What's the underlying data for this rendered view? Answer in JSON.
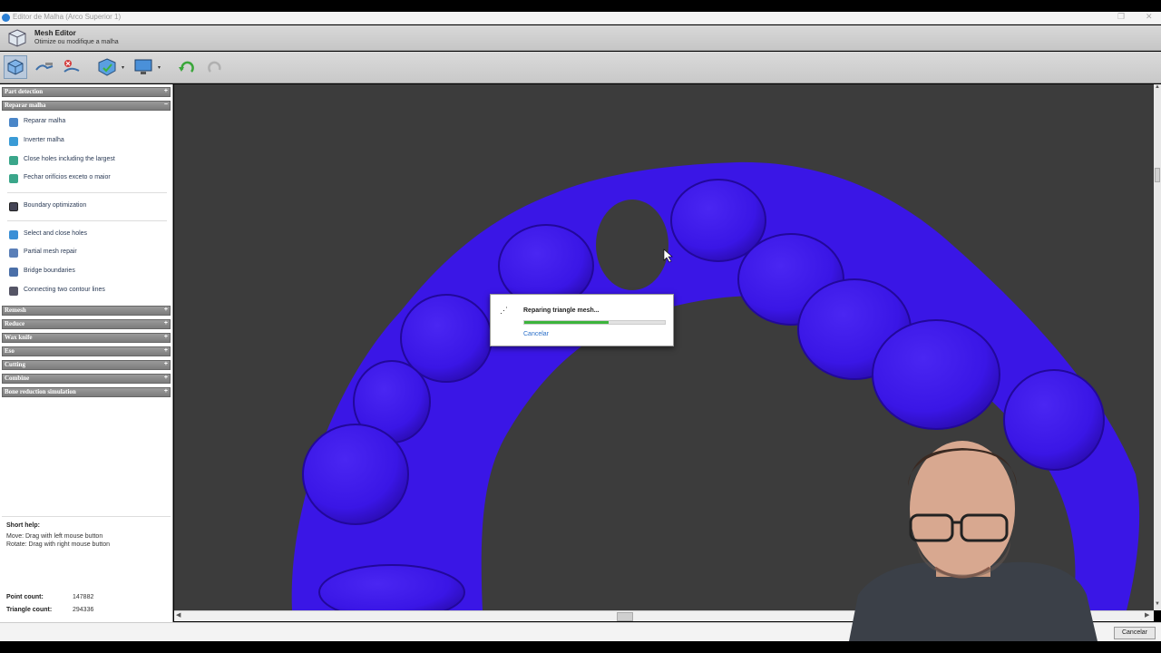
{
  "window": {
    "title": "Editor de Malha (Arco Superior 1)",
    "restore_glyph": "❐",
    "close_glyph": "✕"
  },
  "module": {
    "title": "Mesh Editor",
    "subtitle": "Otimize ou modifique a malha",
    "icon": "mesh-cube-icon"
  },
  "toolbar": {
    "buttons": [
      {
        "name": "select-tool-button",
        "icon": "cube-select-icon",
        "active": true
      },
      {
        "name": "smooth-tool-button",
        "icon": "smooth-brush-icon"
      },
      {
        "name": "remove-tool-button",
        "icon": "remove-icon"
      },
      {
        "name": "view-shield-button",
        "icon": "shield-cube-icon"
      },
      {
        "name": "display-button",
        "icon": "monitor-icon"
      },
      {
        "name": "undo-button",
        "icon": "undo-icon"
      },
      {
        "name": "redo-button",
        "icon": "redo-icon",
        "disabled": true
      }
    ],
    "dropdown_glyph": "▾"
  },
  "sidebar": {
    "sections": [
      {
        "label": "Part detection",
        "toggle": "+"
      },
      {
        "label": "Reparar malha",
        "toggle": "−"
      },
      {
        "label": "Remesh",
        "toggle": "+"
      },
      {
        "label": "Reduce",
        "toggle": "+"
      },
      {
        "label": "Wax knife",
        "toggle": "+"
      },
      {
        "label": "Eso",
        "toggle": "+"
      },
      {
        "label": "Cutting",
        "toggle": "+"
      },
      {
        "label": "Combine",
        "toggle": "+"
      },
      {
        "label": "Bone reduction simulation",
        "toggle": "+"
      }
    ],
    "items": [
      {
        "label": "Reparar malha",
        "icon": "repair-mesh-icon"
      },
      {
        "label": "Inverter malha",
        "icon": "invert-mesh-icon"
      },
      {
        "label": "Close holes including the largest",
        "icon": "close-holes-icon"
      },
      {
        "label": "Fechar orifícios exceto o maior",
        "icon": "close-holes-except-icon"
      },
      {
        "label": "Boundary optimization",
        "icon": "boundary-icon"
      },
      {
        "label": "Select and close holes",
        "icon": "select-holes-icon"
      },
      {
        "label": "Partial mesh repair",
        "icon": "partial-repair-icon"
      },
      {
        "label": "Bridge boundaries",
        "icon": "bridge-icon"
      },
      {
        "label": "Connecting two contour lines",
        "icon": "contour-icon"
      }
    ],
    "help": {
      "title": "Short help:",
      "lines": [
        "Move: Drag with left mouse button",
        "Rotate: Drag with right mouse button"
      ]
    },
    "stats": {
      "point_label": "Point count:",
      "point_value": "147882",
      "triangle_label": "Triangle count:",
      "triangle_value": "294336"
    }
  },
  "dialog": {
    "message": "Reparing triangle mesh...",
    "cancel": "Cancelar",
    "progress": 0.6,
    "spinner_glyph": "⋰"
  },
  "statusbar": {
    "cancel": "Cancelar"
  },
  "scroll": {
    "up": "▲",
    "down": "▼",
    "left": "◀",
    "right": "▶"
  },
  "colors": {
    "mesh": "#3a16e6",
    "mesh_shadow": "#22089a",
    "viewport_bg": "#3c3c3c",
    "progress": "#3cb43c"
  }
}
